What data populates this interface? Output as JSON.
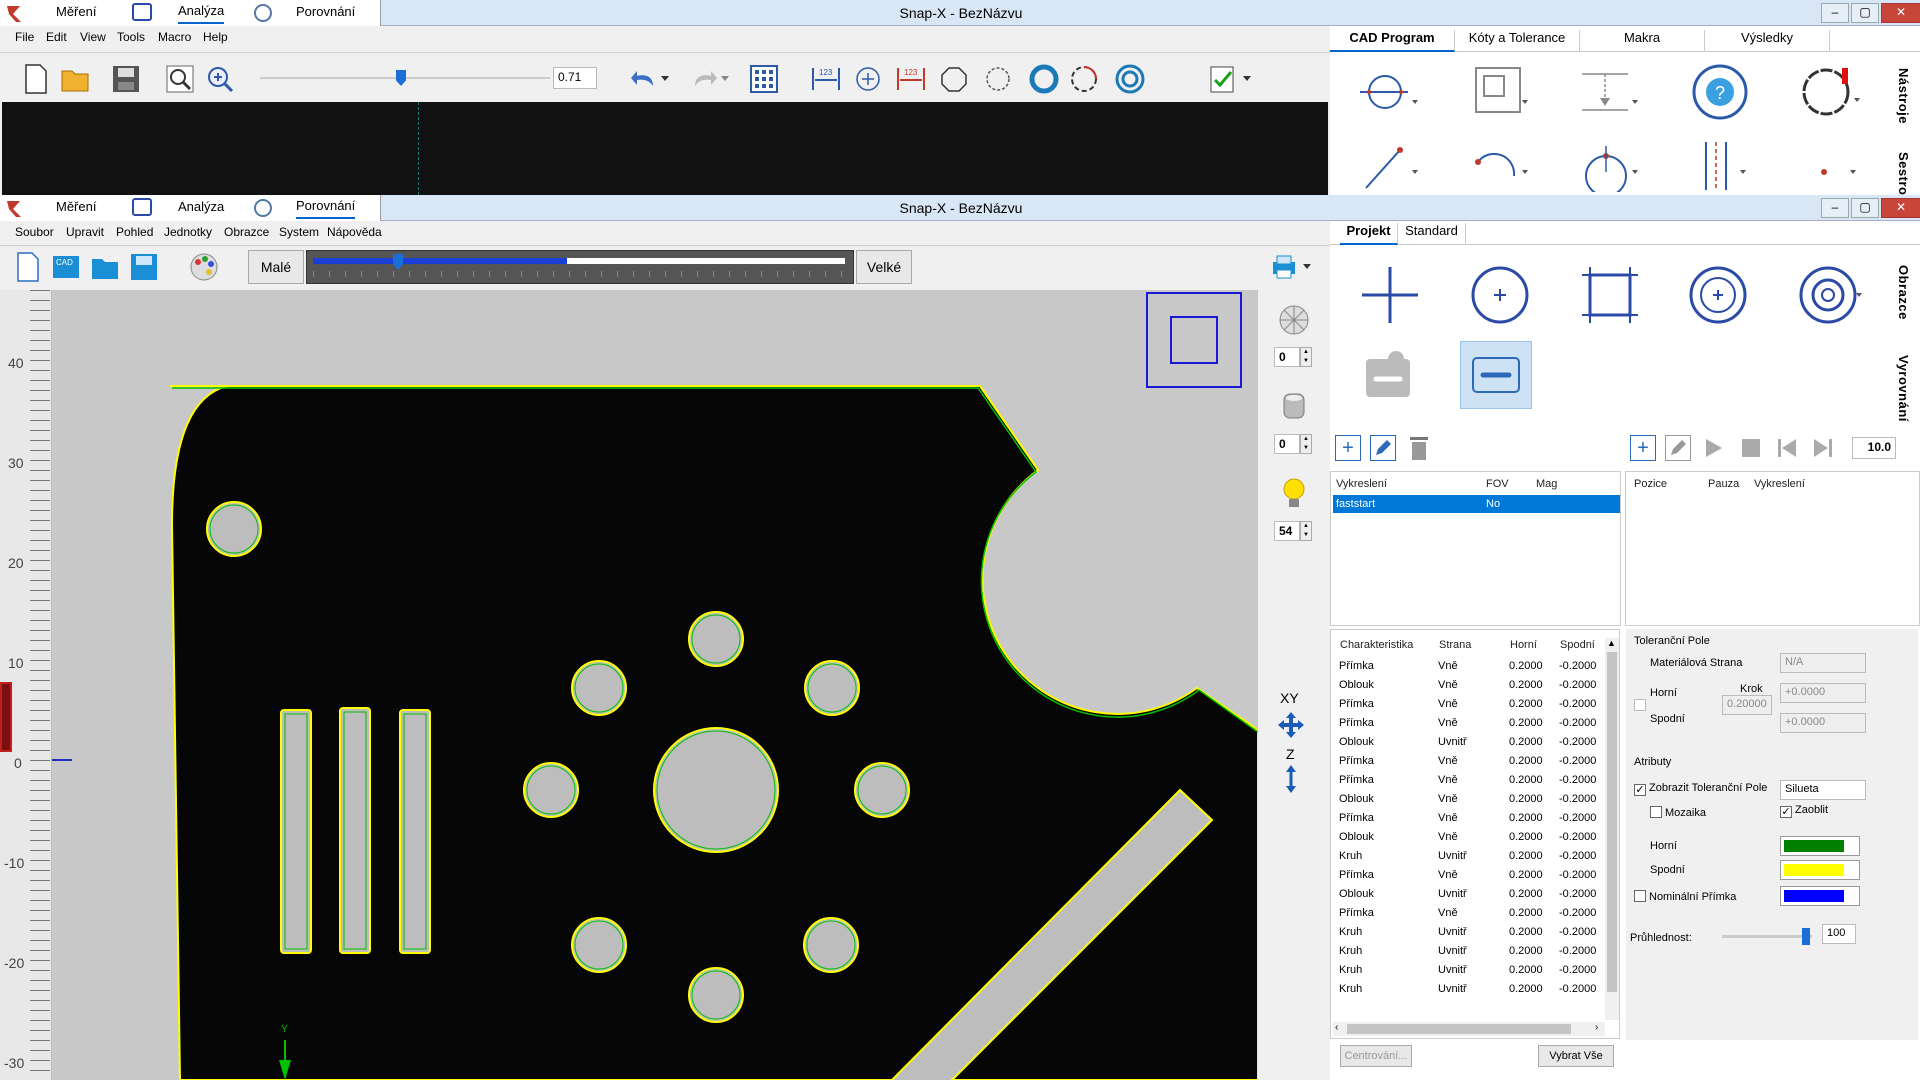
{
  "top_window": {
    "app_tabs": [
      "Měření",
      "Analýza",
      "Porovnání"
    ],
    "active_tab": "Analýza",
    "title": "Snap-X - BezNázvu",
    "menu": [
      "File",
      "Edit",
      "View",
      "Tools",
      "Macro",
      "Help"
    ],
    "zoom_value": "0.71",
    "right_tabs": [
      "CAD Program",
      "Kóty a Tolerance",
      "Makra",
      "Výsledky"
    ],
    "side_labels": [
      "Nástroje",
      "Sestro"
    ]
  },
  "main_window": {
    "app_tabs": [
      "Měření",
      "Analýza",
      "Porovnání"
    ],
    "active_tab": "Porovnání",
    "title": "Snap-X - BezNázvu",
    "menu": [
      "Soubor",
      "Upravit",
      "Pohled",
      "Jednotky",
      "Obrazce",
      "System",
      "Nápověda"
    ],
    "size_small": "Malé",
    "size_large": "Velké",
    "right_tabs": [
      "Projekt",
      "Standard"
    ],
    "side_labels": [
      "Obrazce",
      "Vyrovnání"
    ],
    "ruler_labels": [
      "40",
      "30",
      "20",
      "10",
      "0",
      "-10",
      "-20",
      "-30"
    ],
    "light_values": [
      "0",
      "0",
      "54"
    ],
    "axis_labels": {
      "xy": "XY",
      "z": "Z",
      "y": "Y"
    },
    "step_value": "10.0",
    "project_table": {
      "headers": [
        "Vykreslení",
        "FOV",
        "Mag"
      ],
      "rows": [
        {
          "name": "faststart",
          "fov": "No",
          "mag": ""
        }
      ]
    },
    "sequence_table": {
      "headers": [
        "Pozice",
        "Pauza",
        "Vykreslení"
      ]
    },
    "tolerance_table": {
      "headers": [
        "Charakteristika",
        "Strana",
        "Horní",
        "Spodní"
      ],
      "rows": [
        [
          "Přímka",
          "Vně",
          "0.2000",
          "-0.2000"
        ],
        [
          "Oblouk",
          "Vně",
          "0.2000",
          "-0.2000"
        ],
        [
          "Přímka",
          "Vně",
          "0.2000",
          "-0.2000"
        ],
        [
          "Přímka",
          "Vně",
          "0.2000",
          "-0.2000"
        ],
        [
          "Oblouk",
          "Uvnitř",
          "0.2000",
          "-0.2000"
        ],
        [
          "Přímka",
          "Vně",
          "0.2000",
          "-0.2000"
        ],
        [
          "Přímka",
          "Vně",
          "0.2000",
          "-0.2000"
        ],
        [
          "Oblouk",
          "Vně",
          "0.2000",
          "-0.2000"
        ],
        [
          "Přímka",
          "Vně",
          "0.2000",
          "-0.2000"
        ],
        [
          "Oblouk",
          "Vně",
          "0.2000",
          "-0.2000"
        ],
        [
          "Kruh",
          "Uvnitř",
          "0.2000",
          "-0.2000"
        ],
        [
          "Přímka",
          "Vně",
          "0.2000",
          "-0.2000"
        ],
        [
          "Oblouk",
          "Uvnitř",
          "0.2000",
          "-0.2000"
        ],
        [
          "Přímka",
          "Vně",
          "0.2000",
          "-0.2000"
        ],
        [
          "Kruh",
          "Uvnitř",
          "0.2000",
          "-0.2000"
        ],
        [
          "Kruh",
          "Uvnitř",
          "0.2000",
          "-0.2000"
        ],
        [
          "Kruh",
          "Uvnitř",
          "0.2000",
          "-0.2000"
        ],
        [
          "Kruh",
          "Uvnitř",
          "0.2000",
          "-0.2000"
        ]
      ]
    },
    "tolerance_panel": {
      "group_title": "Toleranční Pole",
      "material_side_label": "Materiálová Strana",
      "material_side_value": "N/A",
      "upper_label": "Horní",
      "lower_label": "Spodní",
      "step_label": "Krok",
      "step_value": "0.20000",
      "upper_value": "+0.0000",
      "lower_value": "+0.0000"
    },
    "attributes_panel": {
      "group_title": "Atributy",
      "show_tolerance_label": "Zobrazit Toleranční Pole",
      "show_tolerance_checked": true,
      "style_value": "Silueta",
      "mosaic_label": "Mozaika",
      "mosaic_checked": false,
      "round_label": "Zaoblit",
      "round_checked": true,
      "upper_color_label": "Horní",
      "upper_color": "#008000",
      "lower_color_label": "Spodní",
      "lower_color": "#ffff00",
      "nominal_label": "Nominální Přímka",
      "nominal_checked": false,
      "nominal_color": "#0000ff",
      "transparency_label": "Průhlednost:",
      "transparency_value": "100"
    },
    "buttons": {
      "center": "Centrování...",
      "select_all": "Vybrat Vše"
    }
  }
}
